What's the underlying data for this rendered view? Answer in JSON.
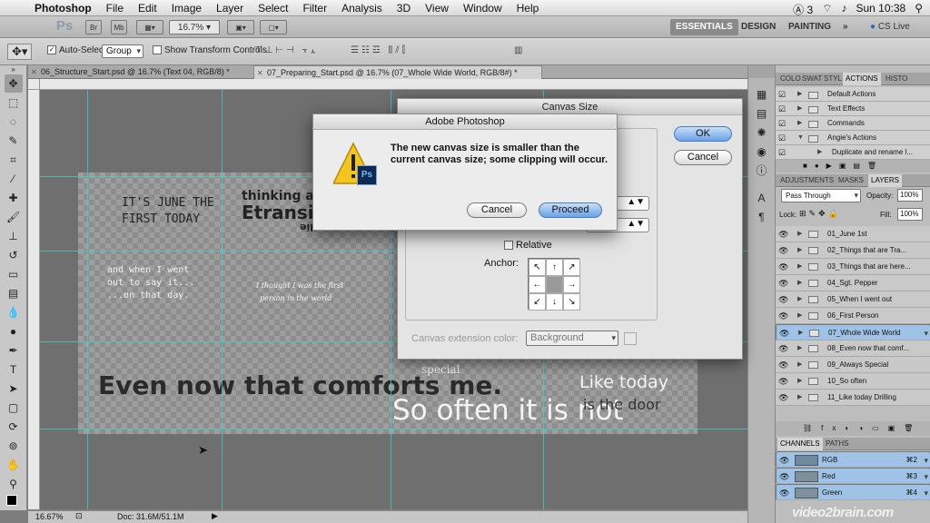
{
  "menubar": {
    "app_name": "Photoshop",
    "items": [
      "File",
      "Edit",
      "Image",
      "Layer",
      "Select",
      "Filter",
      "Analysis",
      "3D",
      "View",
      "Window",
      "Help"
    ],
    "status": {
      "adobe_badge": "3",
      "clock": "Sun 10:38"
    }
  },
  "appbar": {
    "ps_label": "Ps",
    "br_label": "Br",
    "mb_label": "Mb",
    "zoom": "16.7%",
    "workspaces": [
      "ESSENTIALS",
      "DESIGN",
      "PAINTING"
    ],
    "more": "»",
    "cslive": "CS Live"
  },
  "options": {
    "auto_select_label": "Auto-Select:",
    "auto_select_value": "Group",
    "transform_label": "Show Transform Controls"
  },
  "tabs": [
    {
      "label": "06_Structure_Start.psd @ 16.7% (Text 04, RGB/8) *"
    },
    {
      "label": "07_Preparing_Start.psd @ 16.7% (07_Whole Wide World, RGB/8#) *"
    }
  ],
  "canvas_text": {
    "t1a": "IT'S JUNE THE",
    "t1b": "FIRST TODAY",
    "t2a": "thinking a",
    "t2b": "Etransi",
    "t2c": "alie",
    "t3a": "and when I went",
    "t3b": "out to say it...",
    "t3c": "...on that day.",
    "t4a": "I thought I was the first",
    "t4b": "person in the world",
    "t5": "Even now that comforts me.",
    "t6": "So often it is not",
    "t7a": "Like today",
    "t7b": "is the door",
    "t8": "special"
  },
  "statusbar": {
    "zoom": "16.67%",
    "doc": "Doc: 31.6M/51.1M"
  },
  "canvas_size_dialog": {
    "title": "Canvas Size",
    "ok": "OK",
    "cancel": "Cancel",
    "relative": "Relative",
    "anchor": "Anchor:",
    "ext_label": "Canvas extension color:",
    "ext_value": "Background"
  },
  "alert_dialog": {
    "title": "Adobe Photoshop",
    "message": "The new canvas size is smaller than the current canvas size; some clipping will occur.",
    "cancel": "Cancel",
    "proceed": "Proceed",
    "ps_badge": "Ps"
  },
  "panels": {
    "actions_tabs": [
      "COLO",
      "SWAT",
      "STYL",
      "ACTIONS",
      "HISTO"
    ],
    "actions": [
      "Default Actions",
      "Text Effects",
      "Commands",
      "Angie's Actions",
      "Duplicate and rename l..."
    ],
    "layers_tabs": [
      "ADJUSTMENTS",
      "MASKS",
      "LAYERS"
    ],
    "blend_mode": "Pass Through",
    "opacity_label": "Opacity:",
    "opacity": "100%",
    "lock_label": "Lock:",
    "fill_label": "Fill:",
    "fill": "100%",
    "layers": [
      "01_June 1st",
      "02_Things that are Tra...",
      "03_Things that are here...",
      "04_Sgt. Pepper",
      "05_When I went out",
      "06_First Person",
      "07_Whole Wide World",
      "08_Even now that comf...",
      "09_Always Special",
      "10_So often",
      "11_Like today Drilling"
    ],
    "selected_layer": "07_Whole Wide World",
    "channels_tabs": [
      "CHANNELS",
      "PATHS"
    ],
    "channels": [
      {
        "name": "RGB",
        "shortcut": "⌘2"
      },
      {
        "name": "Red",
        "shortcut": "⌘3"
      },
      {
        "name": "Green",
        "shortcut": "⌘4"
      }
    ]
  },
  "watermark": "video2brain.com"
}
